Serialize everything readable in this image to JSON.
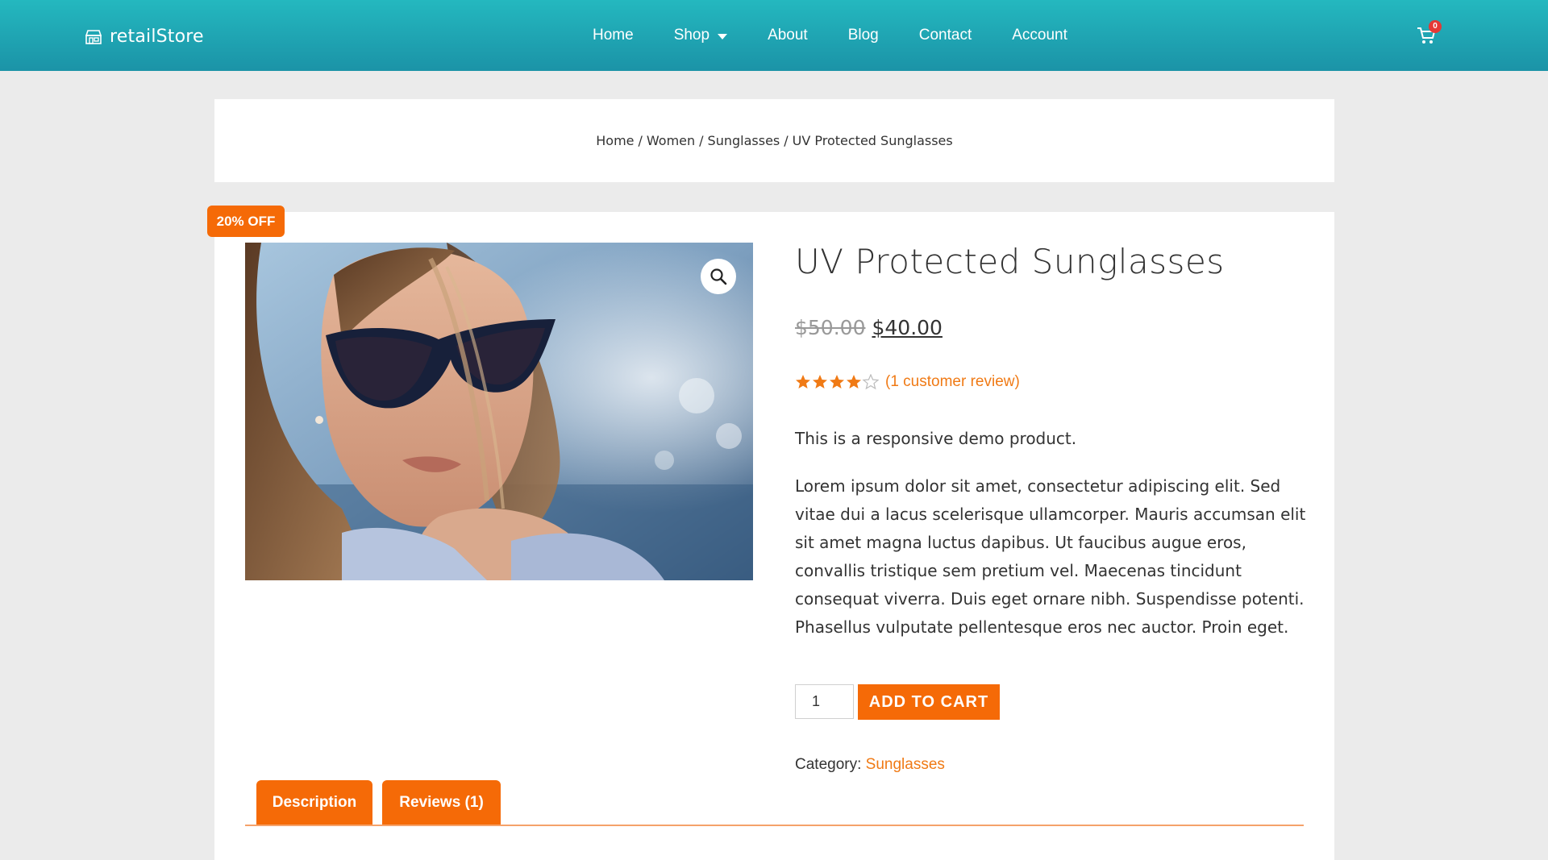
{
  "brand": {
    "name": "retailStore",
    "accent": "#f56a07",
    "header_gradient": [
      "#24b8bf",
      "#1b93a7"
    ]
  },
  "nav": {
    "items": [
      {
        "label": "Home"
      },
      {
        "label": "Shop",
        "has_dropdown": true
      },
      {
        "label": "About"
      },
      {
        "label": "Blog"
      },
      {
        "label": "Contact"
      },
      {
        "label": "Account"
      }
    ]
  },
  "cart": {
    "count": "0",
    "icon": "shopping-cart-icon"
  },
  "breadcrumb": {
    "items": [
      "Home",
      "Women",
      "Sunglasses",
      "UV Protected Sunglasses"
    ],
    "separator": "/"
  },
  "product": {
    "sale_badge": "20% OFF",
    "title": "UV Protected Sunglasses",
    "old_price": "$50.00",
    "price": "$40.00",
    "rating": {
      "value": 4,
      "max": 5,
      "review_text": "(1 customer review)"
    },
    "short_description": "This is a responsive demo product.",
    "description": "Lorem ipsum dolor sit amet, consectetur adipiscing elit. Sed vitae dui a lacus scelerisque ullamcorper. Mauris accumsan elit sit amet magna luctus dapibus. Ut faucibus augue eros, convallis tristique sem pretium vel. Maecenas tincidunt consequat viverra. Duis eget ornare nibh. Suspendisse potenti. Phasellus vulputate pellentesque eros nec auctor. Proin eget.",
    "quantity": "1",
    "add_to_cart_label": "ADD TO CART",
    "category_label": "Category:",
    "category": "Sunglasses",
    "zoom_icon": "magnifier-icon"
  },
  "tabs": [
    {
      "label": "Description"
    },
    {
      "label": "Reviews (1)"
    }
  ]
}
